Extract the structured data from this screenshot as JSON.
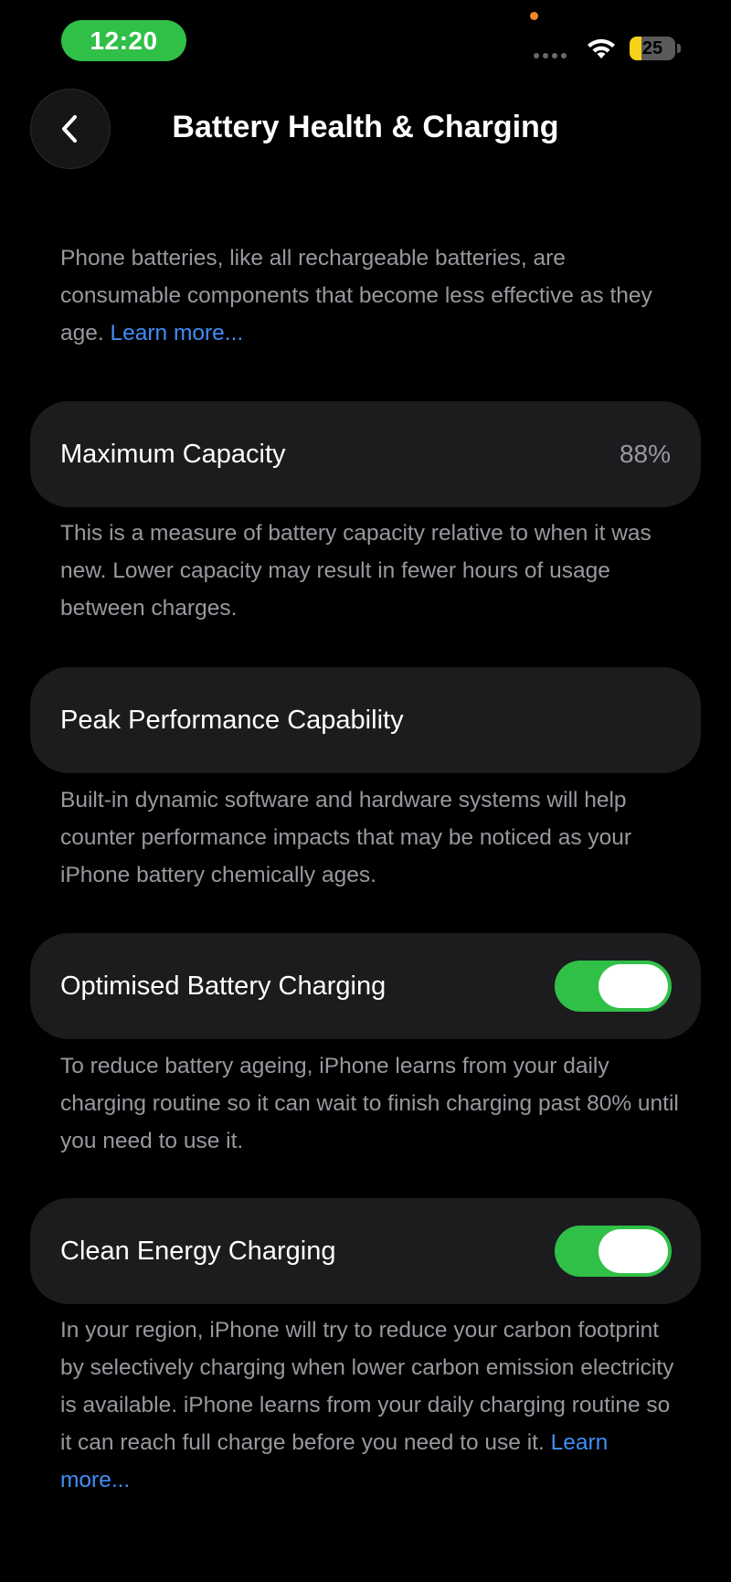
{
  "status_bar": {
    "time": "12:20",
    "battery_level": "25",
    "battery_fill_percent": 25,
    "colors": {
      "time_pill": "#30c048",
      "privacy_dot": "#f08a24",
      "battery_fill": "#f5d11a"
    }
  },
  "nav": {
    "back_icon": "chevron-left-icon",
    "title": "Battery Health & Charging"
  },
  "intro": {
    "text": "Phone batteries, like all rechargeable batteries, are consumable components that become less effective as they age. ",
    "link": "Learn more..."
  },
  "maximum_capacity": {
    "label": "Maximum Capacity",
    "value": "88%",
    "description": "This is a measure of battery capacity relative to when it was new. Lower capacity may result in fewer hours of usage between charges."
  },
  "peak_performance": {
    "label": "Peak Performance Capability",
    "description": "Built-in dynamic software and hardware systems will help counter performance impacts that may be noticed as your iPhone battery chemically ages."
  },
  "optimised_charging": {
    "label": "Optimised Battery Charging",
    "enabled": true,
    "description": "To reduce battery ageing, iPhone learns from your daily charging routine so it can wait to finish charging past 80% until you need to use it."
  },
  "clean_energy": {
    "label": "Clean Energy Charging",
    "enabled": true,
    "description": "In your region, iPhone will try to reduce your carbon footprint by selectively charging when lower carbon emission electricity is available. iPhone learns from your daily charging routine so it can reach full charge before you need to use it. ",
    "link": "Learn more..."
  },
  "colors": {
    "background": "#000000",
    "card": "#1c1c1e",
    "secondary_text": "#98989f",
    "link": "#3e8ef7",
    "toggle_on": "#30c048"
  }
}
